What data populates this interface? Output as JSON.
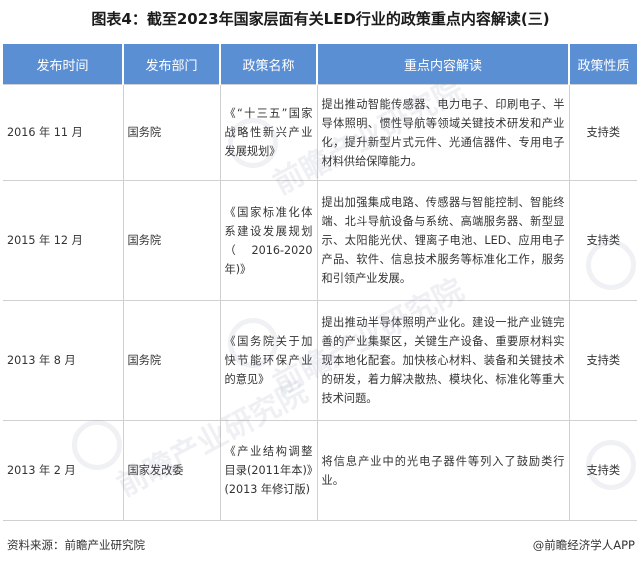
{
  "title": "图表4：截至2023年国家层面有关LED行业的政策重点内容解读(三)",
  "columns": [
    "发布时间",
    "发布部门",
    "政策名称",
    "重点内容解读",
    "政策性质"
  ],
  "rows": [
    {
      "date": "2016 年 11 月",
      "dept": "国务院",
      "name": "《“十三五”国家战略性新兴产业发展规划》",
      "content": "提出推动智能传感器、电力电子、印刷电子、半导体照明、惯性导航等领域关键技术研发和产业化，提升新型片式元件、光通信器件、专用电子材料供给保障能力。",
      "type": "支持类"
    },
    {
      "date": "2015 年 12 月",
      "dept": "国务院",
      "name": "《国家标准化体系建设发展规划（2016-2020年)》",
      "content": "提出加强集成电路、传感器与智能控制、智能终端、北斗导航设备与系统、高端服务器、新型显示、太阳能光伏、锂离子电池、LED、应用电子产品、软件、信息技术服务等标准化工作，服务和引领产业发展。",
      "type": "支持类"
    },
    {
      "date": "2013 年 8 月",
      "dept": "国务院",
      "name": "《国务院关于加快节能环保产业的意见》",
      "content": "提出推动半导体照明产业化。建设一批产业链完善的产业集聚区，关键生产设备、重要原材料实现本地化配套。加快核心材料、装备和关键技术的研发，着力解决散热、模块化、标准化等重大技术问题。",
      "type": "支持类"
    },
    {
      "date": "2013 年 2 月",
      "dept": "国家发改委",
      "name": "《产业结构调整目录(2011年本)》(2013 年修订版)",
      "content": "将信息产业中的光电子器件等列入了鼓励类行业。",
      "type": "支持类"
    }
  ],
  "footer": {
    "source": "资料来源：前瞻产业研究院",
    "brand": "@前瞻经济学人APP"
  },
  "watermark": "前瞻产业研究院"
}
